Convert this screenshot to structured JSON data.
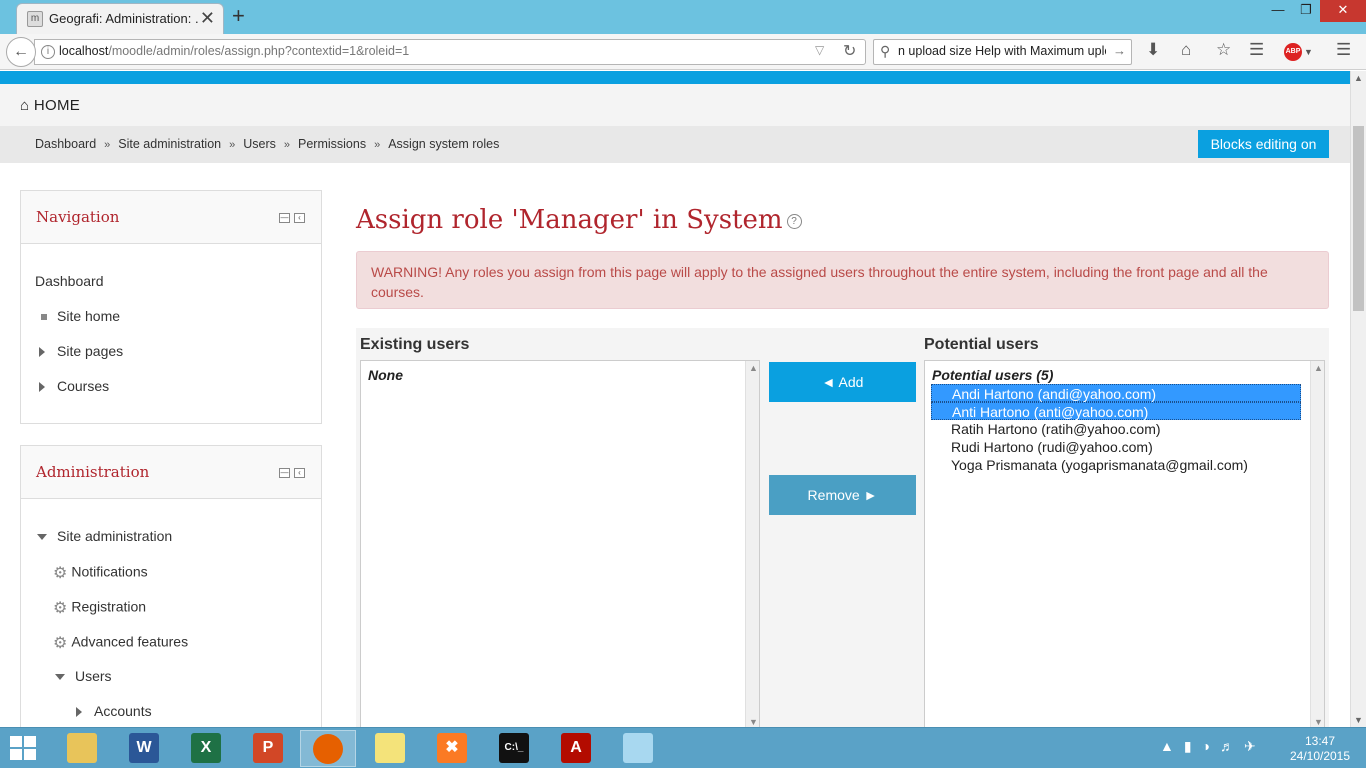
{
  "browser": {
    "tab_title": "Geografi: Administration: ...",
    "tab_close": "✕",
    "new_tab": "+",
    "url_host": "localhost",
    "url_path": "/moodle/admin/roles/assign.php?contextid=1&roleid=1",
    "search_value": "n upload size Help with Maximum uploa"
  },
  "site": {
    "home_label": "HOME",
    "blocks_editing_label": "Blocks editing on",
    "breadcrumb": [
      "Dashboard",
      "Site administration",
      "Users",
      "Permissions",
      "Assign system roles"
    ],
    "breadcrumb_sep": "»"
  },
  "navigation": {
    "title": "Navigation",
    "dashboard": "Dashboard",
    "items": [
      "Site home",
      "Site pages",
      "Courses"
    ]
  },
  "administration": {
    "title": "Administration",
    "site_admin": "Site administration",
    "items": [
      "Notifications",
      "Registration",
      "Advanced features"
    ],
    "users": "Users",
    "accounts": "Accounts"
  },
  "main": {
    "title": "Assign role 'Manager' in System",
    "warning": "WARNING! Any roles you assign from this page will apply to the assigned users throughout the entire system, including the front page and all the courses.",
    "existing_label": "Existing users",
    "existing_none": "None",
    "potential_label": "Potential users",
    "potential_group": "Potential users (5)",
    "potential_users": [
      "Andi Hartono (andi@yahoo.com)",
      "Anti Hartono (anti@yahoo.com)",
      "Ratih Hartono (ratih@yahoo.com)",
      "Rudi Hartono (rudi@yahoo.com)",
      "Yoga Prismanata (yogaprismanata@gmail.com)"
    ],
    "selected_count": 2,
    "add_label": "◄ Add",
    "remove_label": "Remove ►"
  },
  "taskbar": {
    "time": "13:47",
    "date": "24/10/2015"
  },
  "colors": {
    "accent": "#0aa0e0",
    "title_red": "#b0252d",
    "selected": "#3399ff"
  }
}
